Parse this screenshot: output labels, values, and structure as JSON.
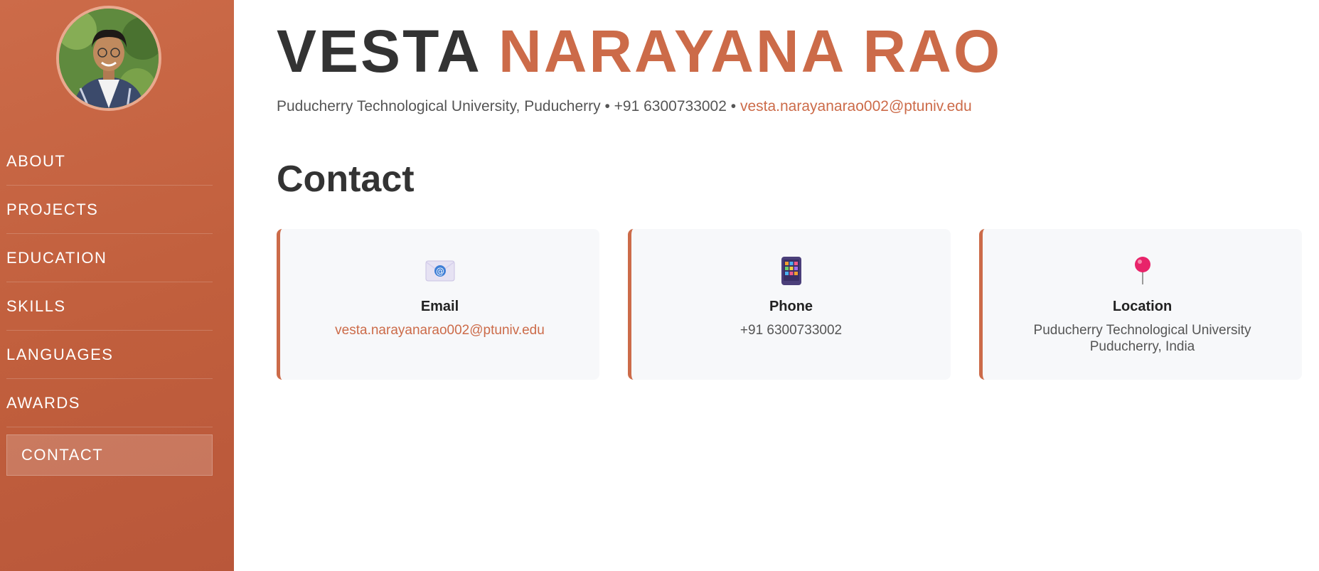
{
  "sidebar": {
    "nav": [
      {
        "label": "ABOUT"
      },
      {
        "label": "PROJECTS"
      },
      {
        "label": "EDUCATION"
      },
      {
        "label": "SKILLS"
      },
      {
        "label": "LANGUAGES"
      },
      {
        "label": "AWARDS"
      },
      {
        "label": "CONTACT",
        "active": true
      }
    ]
  },
  "header": {
    "first_name": "VESTA",
    "last_name": "NARAYANA RAO",
    "university": "Puducherry Technological University, Puducherry",
    "separator": "•",
    "phone": "+91 6300733002",
    "email": "vesta.narayanarao002@ptuniv.edu"
  },
  "section": {
    "title": "Contact"
  },
  "cards": {
    "email": {
      "icon": "envelope-icon",
      "title": "Email",
      "value": "vesta.narayanarao002@ptuniv.edu"
    },
    "phone": {
      "icon": "mobile-phone-icon",
      "title": "Phone",
      "value": "+91 6300733002"
    },
    "location": {
      "icon": "map-pin-icon",
      "title": "Location",
      "line1": "Puducherry Technological University",
      "line2": "Puducherry, India"
    }
  },
  "colors": {
    "accent": "#cc6b49",
    "sidebar_bg": "#c15f3d",
    "text_dark": "#333333",
    "card_bg": "#f7f8fa"
  }
}
